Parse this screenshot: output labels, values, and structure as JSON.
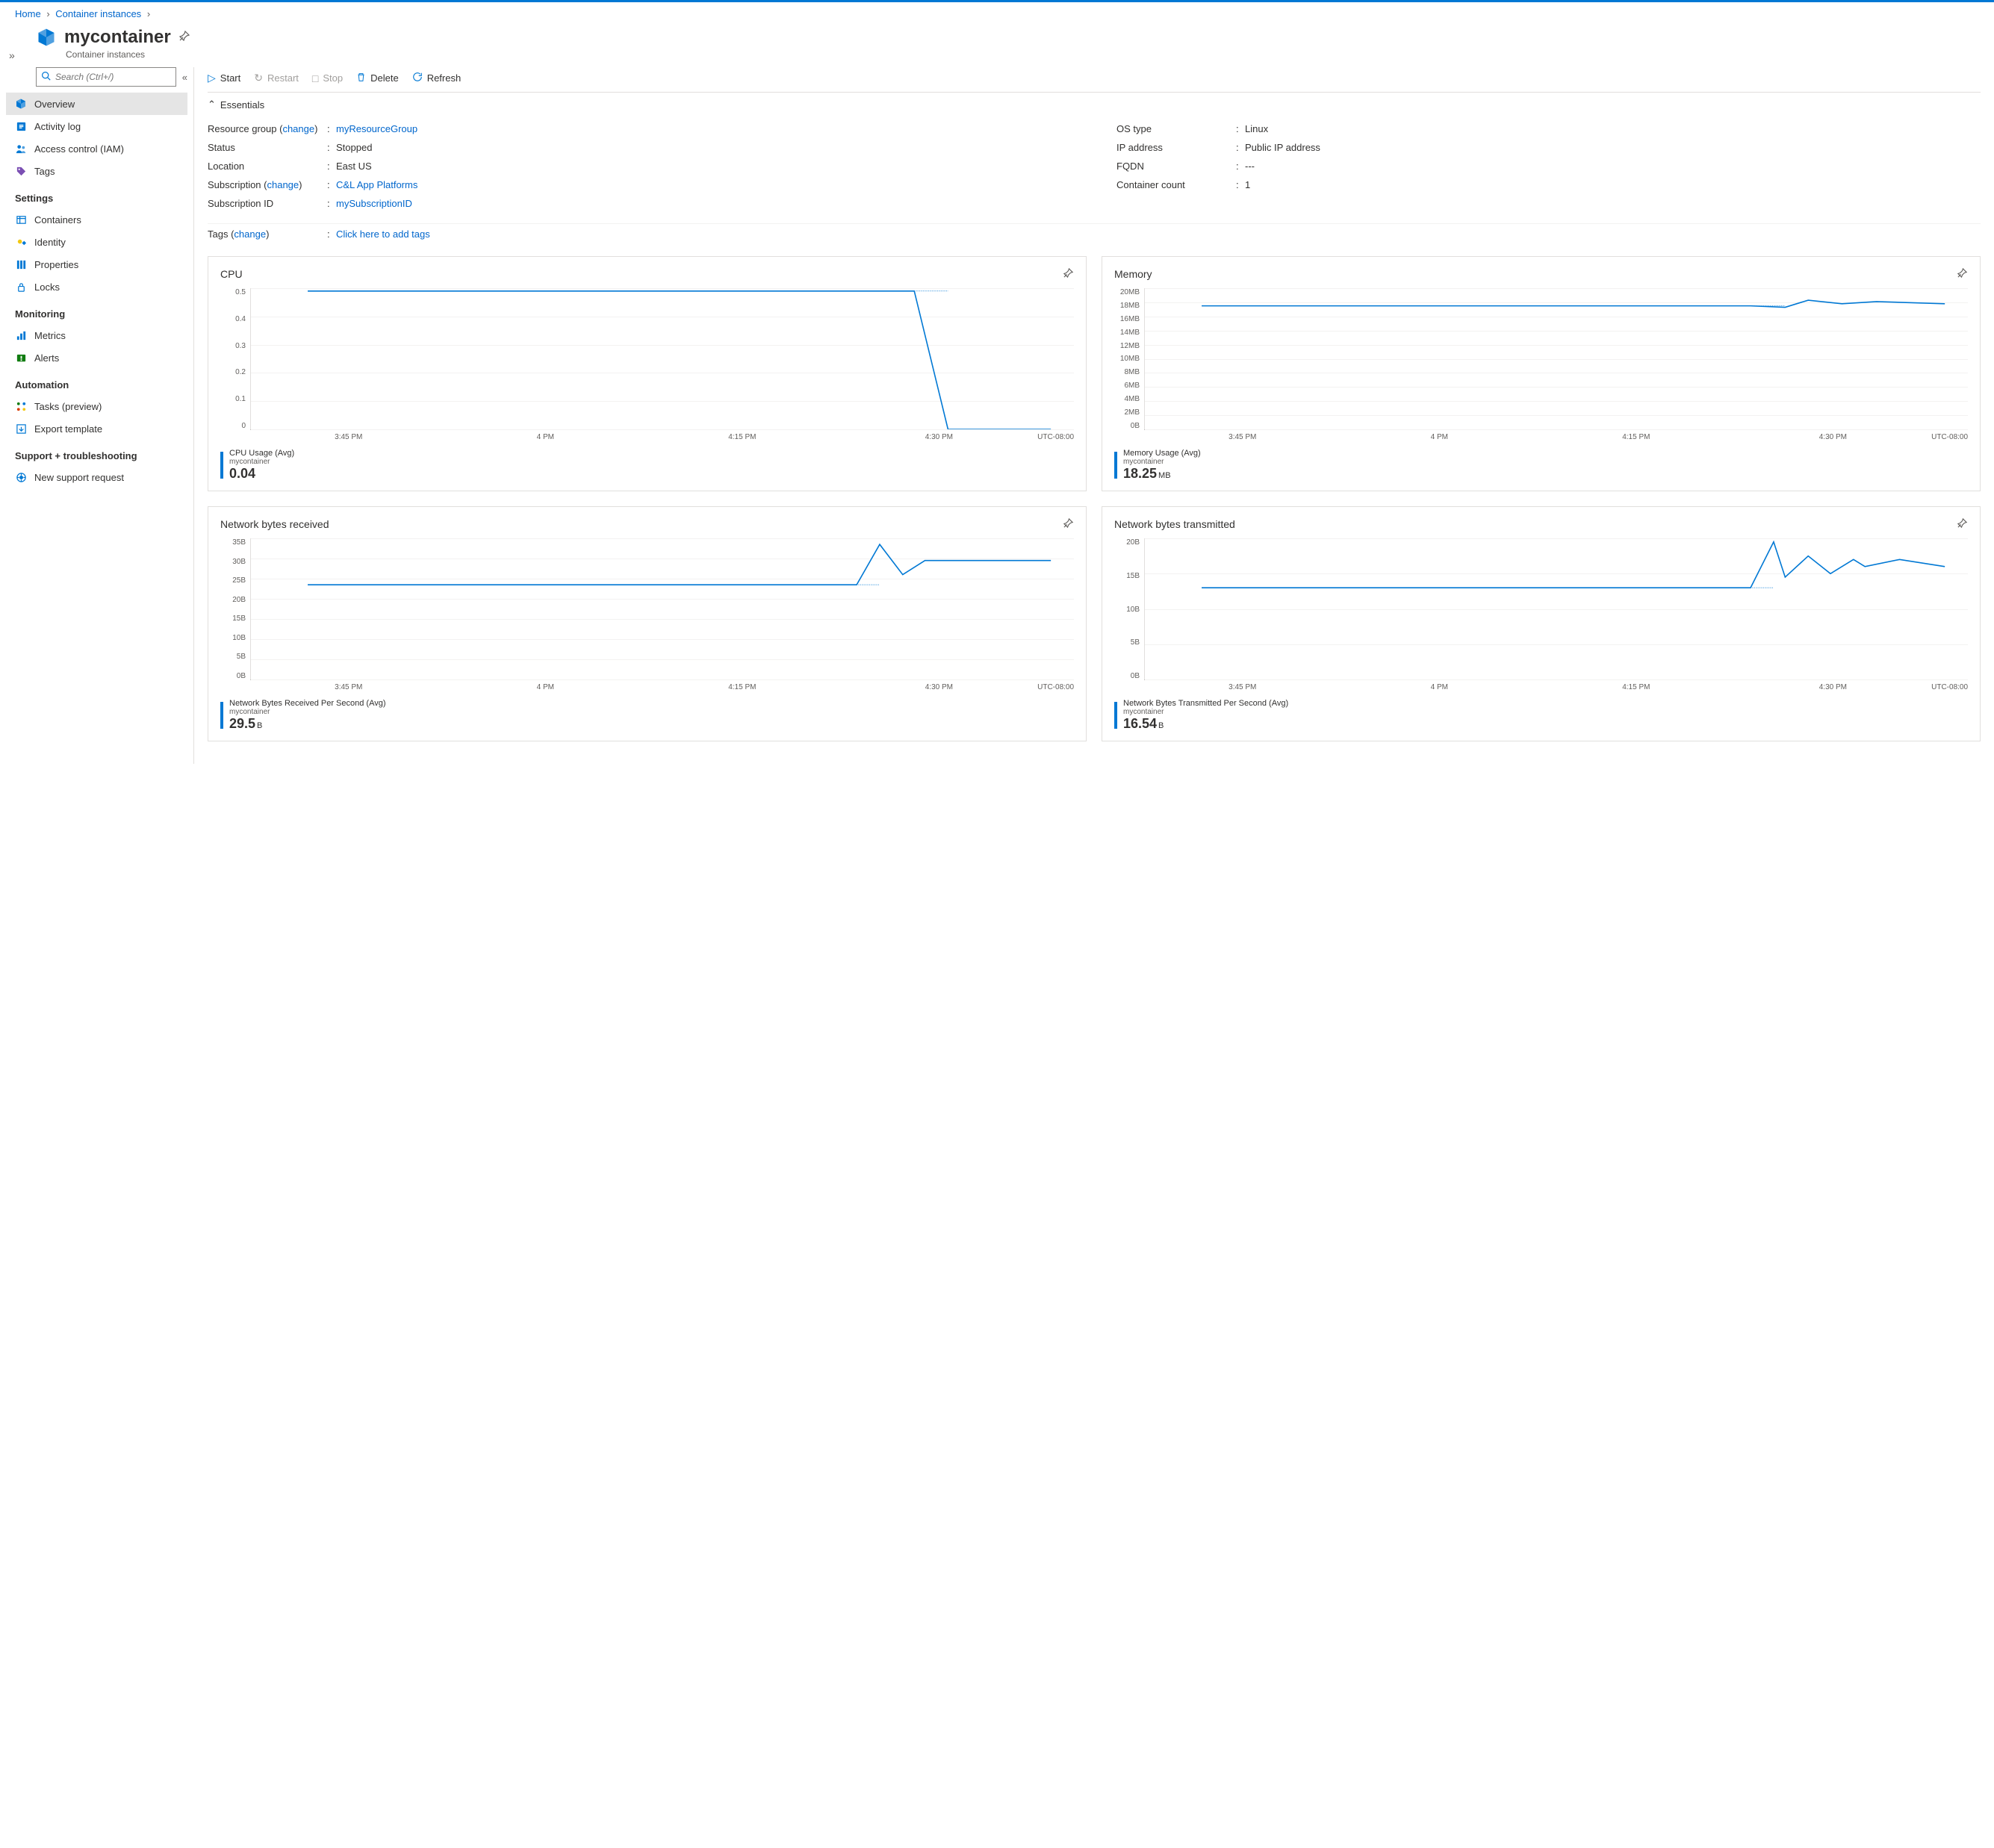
{
  "breadcrumb": {
    "home": "Home",
    "section": "Container instances"
  },
  "header": {
    "title": "mycontainer",
    "subtitle": "Container instances"
  },
  "sidebar": {
    "search_placeholder": "Search (Ctrl+/)",
    "items_top": [
      {
        "label": "Overview",
        "icon": "cube"
      },
      {
        "label": "Activity log",
        "icon": "log"
      },
      {
        "label": "Access control (IAM)",
        "icon": "iam"
      },
      {
        "label": "Tags",
        "icon": "tag"
      }
    ],
    "sections": [
      {
        "title": "Settings",
        "items": [
          {
            "label": "Containers",
            "icon": "containers"
          },
          {
            "label": "Identity",
            "icon": "identity"
          },
          {
            "label": "Properties",
            "icon": "properties"
          },
          {
            "label": "Locks",
            "icon": "lock"
          }
        ]
      },
      {
        "title": "Monitoring",
        "items": [
          {
            "label": "Metrics",
            "icon": "metrics"
          },
          {
            "label": "Alerts",
            "icon": "alerts"
          }
        ]
      },
      {
        "title": "Automation",
        "items": [
          {
            "label": "Tasks (preview)",
            "icon": "tasks"
          },
          {
            "label": "Export template",
            "icon": "export"
          }
        ]
      },
      {
        "title": "Support + troubleshooting",
        "items": [
          {
            "label": "New support request",
            "icon": "support"
          }
        ]
      }
    ]
  },
  "toolbar": {
    "start": "Start",
    "restart": "Restart",
    "stop": "Stop",
    "delete": "Delete",
    "refresh": "Refresh"
  },
  "essentials": {
    "toggle_label": "Essentials",
    "left": [
      {
        "label_pre": "Resource group (",
        "label_link": "change",
        "label_post": ")",
        "value": "myResourceGroup",
        "is_link": true
      },
      {
        "label": "Status",
        "value": "Stopped"
      },
      {
        "label": "Location",
        "value": "East US"
      },
      {
        "label_pre": "Subscription (",
        "label_link": "change",
        "label_post": ")",
        "value": "C&L App Platforms",
        "is_link": true
      },
      {
        "label": "Subscription ID",
        "value": "mySubscriptionID",
        "is_link": true
      }
    ],
    "right": [
      {
        "label": "OS type",
        "value": "Linux"
      },
      {
        "label": "IP address",
        "value": "Public IP address"
      },
      {
        "label": "FQDN",
        "value": "---"
      },
      {
        "label": "Container count",
        "value": "1"
      }
    ],
    "tags_label_pre": "Tags (",
    "tags_label_link": "change",
    "tags_label_post": ")",
    "tags_value": "Click here to add tags"
  },
  "xaxis": {
    "ticks": [
      "3:45 PM",
      "4 PM",
      "4:15 PM",
      "4:30 PM"
    ],
    "tz": "UTC-08:00"
  },
  "chart_data": [
    {
      "type": "line",
      "title": "CPU",
      "yticks": [
        "0.5",
        "0.4",
        "0.3",
        "0.2",
        "0.1",
        "0"
      ],
      "ylim": [
        0,
        0.5
      ],
      "series_label": "CPU Usage (Avg)",
      "series_sub": "mycontainer",
      "value": "0.04",
      "unit": "",
      "x": [
        "3:37 PM",
        "3:45 PM",
        "4 PM",
        "4:15 PM",
        "4:30 PM",
        "4:33 PM",
        "4:42 PM"
      ],
      "values": [
        0.49,
        0.49,
        0.49,
        0.49,
        0.49,
        0.0,
        0.0
      ],
      "avg_line": 0.49
    },
    {
      "type": "line",
      "title": "Memory",
      "yticks": [
        "20MB",
        "18MB",
        "16MB",
        "14MB",
        "12MB",
        "10MB",
        "8MB",
        "6MB",
        "4MB",
        "2MB",
        "0B"
      ],
      "ylim": [
        0,
        20
      ],
      "series_label": "Memory Usage (Avg)",
      "series_sub": "mycontainer",
      "value": "18.25",
      "unit": "MB",
      "x": [
        "3:37 PM",
        "3:45 PM",
        "4 PM",
        "4:15 PM",
        "4:25 PM",
        "4:28 PM",
        "4:30 PM",
        "4:33 PM",
        "4:36 PM",
        "4:42 PM"
      ],
      "values": [
        17.5,
        17.5,
        17.5,
        17.5,
        17.5,
        17.3,
        18.3,
        17.8,
        18.1,
        17.8
      ],
      "avg_line": 17.5
    },
    {
      "type": "line",
      "title": "Network bytes received",
      "yticks": [
        "35B",
        "30B",
        "25B",
        "20B",
        "15B",
        "10B",
        "5B",
        "0B"
      ],
      "ylim": [
        0,
        35
      ],
      "series_label": "Network Bytes Received Per Second (Avg)",
      "series_sub": "mycontainer",
      "value": "29.5",
      "unit": "B",
      "x": [
        "3:37 PM",
        "3:45 PM",
        "4 PM",
        "4:15 PM",
        "4:25 PM",
        "4:27 PM",
        "4:29 PM",
        "4:31 PM",
        "4:42 PM"
      ],
      "values": [
        23.5,
        23.5,
        23.5,
        23.5,
        23.5,
        33.5,
        26.0,
        29.5,
        29.5
      ],
      "avg_line": 23.5
    },
    {
      "type": "line",
      "title": "Network bytes transmitted",
      "yticks": [
        "20B",
        "15B",
        "10B",
        "5B",
        "0B"
      ],
      "ylim": [
        0,
        20
      ],
      "series_label": "Network Bytes Transmitted Per Second (Avg)",
      "series_sub": "mycontainer",
      "value": "16.54",
      "unit": "B",
      "x": [
        "3:37 PM",
        "3:45 PM",
        "4 PM",
        "4:15 PM",
        "4:25 PM",
        "4:27 PM",
        "4:28 PM",
        "4:30 PM",
        "4:32 PM",
        "4:34 PM",
        "4:35 PM",
        "4:38 PM",
        "4:42 PM"
      ],
      "values": [
        13.0,
        13.0,
        13.0,
        13.0,
        13.0,
        19.5,
        14.5,
        17.5,
        15.0,
        17.0,
        16.0,
        17.0,
        16.0
      ],
      "avg_line": 13.0
    }
  ]
}
